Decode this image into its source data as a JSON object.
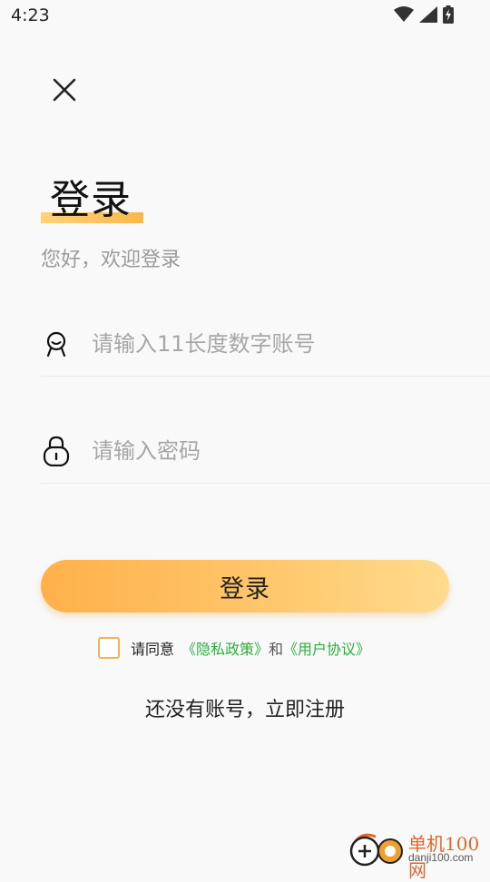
{
  "status_bar": {
    "time": "4:23",
    "icons": [
      "wifi-icon",
      "signal-icon",
      "battery-charging-icon"
    ]
  },
  "header": {
    "close_icon": "close-icon",
    "title": "登录",
    "subtitle": "您好，欢迎登录"
  },
  "form": {
    "account": {
      "icon": "user-icon",
      "placeholder": "请输入11长度数字账号",
      "value": ""
    },
    "password": {
      "icon": "lock-icon",
      "placeholder": "请输入密码",
      "value": ""
    },
    "login_label": "登录"
  },
  "agreement": {
    "checked": false,
    "prefix": "请同意",
    "privacy_link": "《隐私政策》",
    "conjunction": "和",
    "terms_link": "《用户协议》"
  },
  "register_text": "还没有账号，立即注册",
  "watermark": {
    "name": "单机100网",
    "url": "danji100.com"
  },
  "colors": {
    "accent_start": "#ffb04a",
    "accent_end": "#ffdb8e",
    "link_green": "#2bad3f",
    "checkbox_border": "#f6b24e"
  }
}
